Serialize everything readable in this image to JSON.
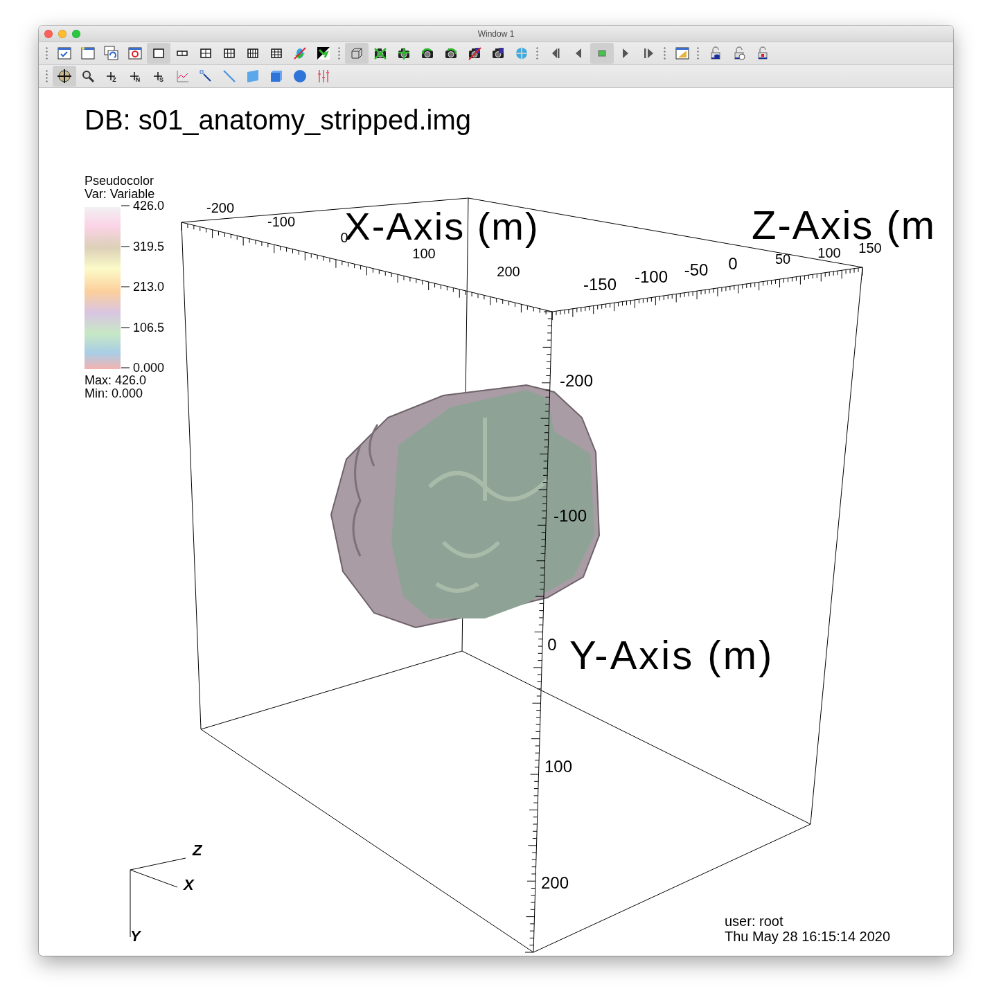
{
  "window": {
    "title": "Window 1"
  },
  "toolbar": {
    "rows": [
      {
        "groups": [
          [
            {
              "kind": "window-check",
              "selected": false
            },
            {
              "kind": "window-new",
              "selected": false
            },
            {
              "kind": "window-clone",
              "selected": false
            },
            {
              "kind": "window-delete",
              "selected": false
            },
            {
              "kind": "layout-1",
              "selected": true
            },
            {
              "kind": "layout-2",
              "selected": false
            },
            {
              "kind": "layout-4",
              "selected": false
            },
            {
              "kind": "layout-6",
              "selected": false
            },
            {
              "kind": "layout-8",
              "selected": false
            },
            {
              "kind": "layout-9",
              "selected": false
            },
            {
              "kind": "lock-view",
              "selected": false
            },
            {
              "kind": "spin",
              "selected": false
            }
          ],
          [
            {
              "kind": "view-3d",
              "selected": true
            },
            {
              "kind": "camera-clear",
              "selected": false
            },
            {
              "kind": "camera-reset",
              "selected": false
            },
            {
              "kind": "camera-undo",
              "selected": false
            },
            {
              "kind": "camera-redo",
              "selected": false
            },
            {
              "kind": "camera-off",
              "selected": false
            },
            {
              "kind": "camera-save",
              "selected": false
            },
            {
              "kind": "globe",
              "selected": false
            }
          ],
          [
            {
              "kind": "step-back",
              "selected": false
            },
            {
              "kind": "back",
              "selected": false
            },
            {
              "kind": "stop",
              "selected": true
            },
            {
              "kind": "play",
              "selected": false
            },
            {
              "kind": "step-forward",
              "selected": false
            }
          ],
          [
            {
              "kind": "palette",
              "selected": false
            }
          ],
          [
            {
              "kind": "lock-eye",
              "selected": false
            },
            {
              "kind": "lock-clock",
              "selected": false
            },
            {
              "kind": "lock-red",
              "selected": false
            }
          ]
        ]
      },
      {
        "groups": [
          [
            {
              "kind": "navigate",
              "selected": true
            },
            {
              "kind": "zoom",
              "selected": false
            },
            {
              "kind": "pick",
              "sub": "Z",
              "selected": false
            },
            {
              "kind": "pick",
              "sub": "N",
              "selected": false
            },
            {
              "kind": "pick",
              "sub": "S",
              "selected": false
            },
            {
              "kind": "lineout",
              "selected": false
            },
            {
              "kind": "point-tool",
              "selected": false
            },
            {
              "kind": "line-tool",
              "selected": false
            },
            {
              "kind": "plane-tool",
              "selected": false
            },
            {
              "kind": "box-tool",
              "selected": false
            },
            {
              "kind": "sphere-tool",
              "selected": false
            },
            {
              "kind": "axes-tool",
              "selected": false
            }
          ]
        ]
      }
    ]
  },
  "plot": {
    "database": "DB: s01_anatomy_stripped.img",
    "legend": {
      "title": "Pseudocolor",
      "variable": "Var: Variable",
      "ticks": [
        "426.0",
        "319.5",
        "213.0",
        "106.5",
        "0.000"
      ],
      "max": "Max:  426.0",
      "min": "Min:  0.000"
    },
    "x_axis": {
      "title": "X-Axis (m)",
      "ticks": [
        "-200",
        "-100",
        "0",
        "100",
        "200"
      ]
    },
    "z_axis": {
      "title": "Z-Axis (m",
      "ticks": [
        "-150",
        "-100",
        "-50",
        "0",
        "50",
        "100",
        "150"
      ]
    },
    "y_axis": {
      "title": "Y-Axis (m)",
      "ticks": [
        "-200",
        "-100",
        "0",
        "100",
        "200"
      ]
    },
    "triad": [
      "Z",
      "X",
      "Y"
    ],
    "user": "user: root",
    "timestamp": "Thu May 28 16:15:14 2020"
  }
}
